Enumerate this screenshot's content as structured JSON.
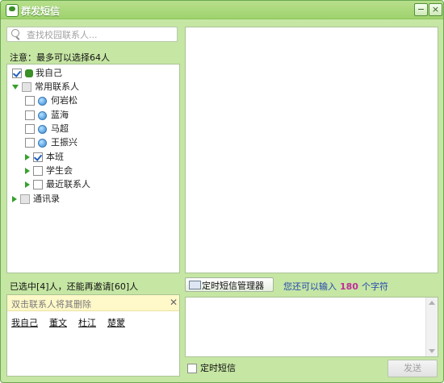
{
  "window": {
    "title": "群发短信",
    "minimize_label": "−",
    "close_label": "×"
  },
  "search": {
    "placeholder": "查找校园联系人..."
  },
  "note": "注意：最多可以选择64人",
  "tree": {
    "items": [
      {
        "label": "我自己",
        "level": 0,
        "checked": true
      },
      {
        "label": "常用联系人",
        "level": 0,
        "expanded": true,
        "partial": true
      },
      {
        "label": "何岩松",
        "level": 1
      },
      {
        "label": "蓝海",
        "level": 1
      },
      {
        "label": "马超",
        "level": 1
      },
      {
        "label": "王振兴",
        "level": 1
      },
      {
        "label": "本班",
        "level": 1,
        "expandable": true,
        "checked": true
      },
      {
        "label": "学生会",
        "level": 1,
        "expandable": true
      },
      {
        "label": "最近联系人",
        "level": 1,
        "expandable": true
      },
      {
        "label": "通讯录",
        "level": 0,
        "expandable": true,
        "partial": true
      }
    ]
  },
  "selected_info": "已选中[4]人，还能再邀请[60]人",
  "recipients": {
    "hint": "双击联系人将其删除",
    "close_label": "✕",
    "names": [
      "我自己",
      "董文",
      "杜江",
      "楚蒙"
    ]
  },
  "compose": {
    "timer_manager_label": "定时短信管理器",
    "remaining_prefix": "您还可以输入",
    "remaining_count": "180",
    "remaining_suffix": "个字符",
    "timed_sms_label": "定时短信",
    "send_label": "发送"
  }
}
